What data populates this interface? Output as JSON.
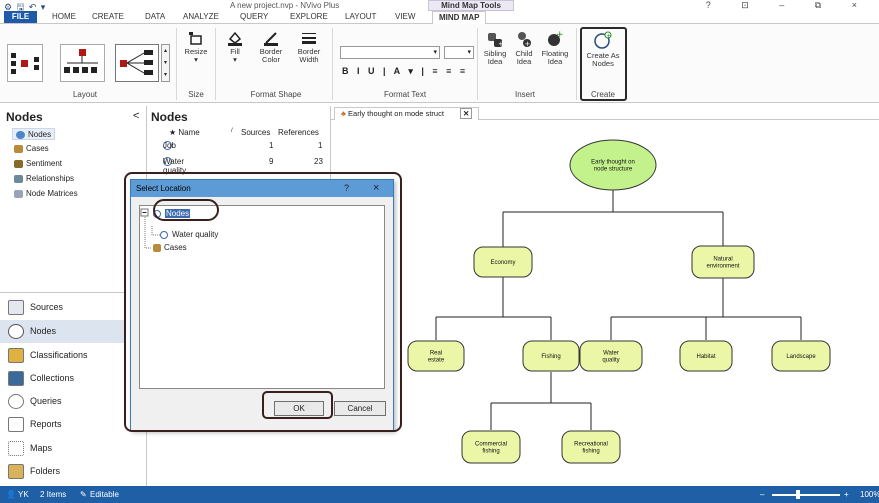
{
  "titlebar": {
    "quick_access": "⚙ 🖫 ↶ ▾",
    "title": "A new project.nvp - NVivo Plus",
    "context_tab_group": "Mind Map Tools",
    "window_controls": "? ⊡ – ⧉ ×"
  },
  "tabs": [
    "FILE",
    "HOME",
    "CREATE",
    "DATA",
    "ANALYZE",
    "QUERY",
    "EXPLORE",
    "LAYOUT",
    "VIEW",
    "MIND MAP"
  ],
  "ribbon": {
    "groups": {
      "layout": "Layout",
      "size": "Size",
      "format_shape": "Format Shape",
      "format_text": "Format Text",
      "insert": "Insert",
      "create": "Create"
    },
    "buttons": {
      "resize": "Resize",
      "fill": "Fill",
      "border_color": "Border Color",
      "border_width": "Border Width",
      "sibling_idea": "Sibling Idea",
      "child_idea": "Child Idea",
      "floating_idea": "Floating Idea",
      "create_as_nodes": "Create As Nodes"
    },
    "format_text_buttons": "B I U | A ▾ | ≡ ≡ ≡"
  },
  "navpane": {
    "title": "Nodes",
    "collapse": "<",
    "items": [
      "Nodes",
      "Cases",
      "Sentiment",
      "Relationships",
      "Node Matrices"
    ]
  },
  "bottomnav": [
    "Sources",
    "Nodes",
    "Classifications",
    "Collections",
    "Queries",
    "Reports",
    "Maps",
    "Folders"
  ],
  "listpane": {
    "title": "Nodes",
    "columns": [
      "Name",
      "Sources",
      "References"
    ],
    "rows": [
      {
        "name": "Job",
        "sources": "1",
        "references": "1"
      },
      {
        "name": "Water quality",
        "sources": "9",
        "references": "23"
      }
    ]
  },
  "map_tab": "Early thought on mode struct",
  "mindmap": {
    "root": "Early thought on node structure",
    "nodes": [
      "Economy",
      "Natural environment",
      "Real estate",
      "Fishing",
      "Water quality",
      "Habitat",
      "Landscape",
      "Commercial fishing",
      "Recreational fishing"
    ]
  },
  "dialog": {
    "title": "Select Location",
    "help": "?",
    "close": "×",
    "tree": {
      "root": "Nodes",
      "child": "Water quality",
      "sibling": "Cases"
    },
    "ok": "OK",
    "cancel": "Cancel"
  },
  "status": {
    "user": "YK",
    "items": "2 Items",
    "editable": "Editable",
    "zoom": "100%"
  },
  "colors": {
    "accent": "#1e5aa8",
    "node_fill": "#ebf7a7",
    "root_fill": "#c3f28c",
    "highlight": "#3a1f1f"
  }
}
